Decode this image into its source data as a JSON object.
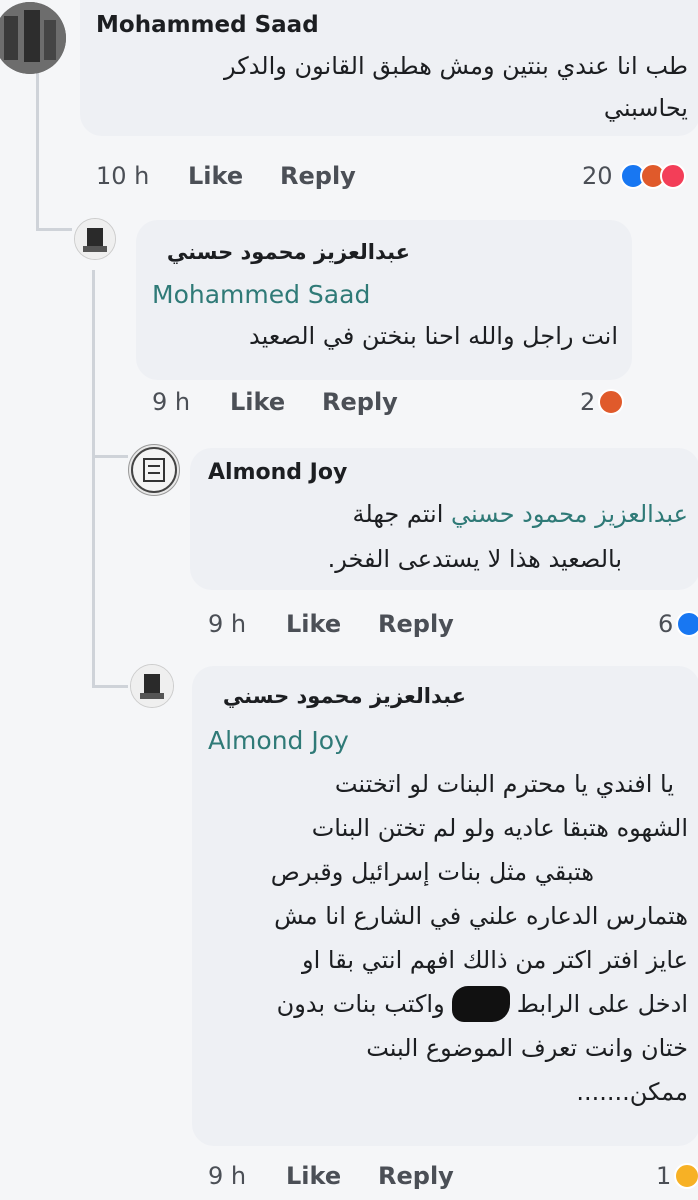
{
  "comments": [
    {
      "author": "Mohammed Saad",
      "mention": "",
      "lines": [
        "طب انا عندي بنتين ومش هطبق القانون والدكر",
        "يحاسبني"
      ],
      "time": "10 h",
      "like_label": "Like",
      "reply_label": "Reply",
      "reaction_count": "20",
      "reactions": [
        "like-icon",
        "angry-icon",
        "love-icon"
      ]
    },
    {
      "author": "عبدالعزيز محمود حسني",
      "mention": "Mohammed Saad",
      "lines": [
        "انت راجل والله احنا بنختن في الصعيد"
      ],
      "time": "9 h",
      "like_label": "Like",
      "reply_label": "Reply",
      "reaction_count": "2",
      "reactions": [
        "angry-icon"
      ]
    },
    {
      "author": "Almond Joy",
      "mention": "عبدالعزيز محمود حسني",
      "lines": [
        "انتم جهلة",
        "بالصعيد هذا لا يستدعى الفخر."
      ],
      "time": "9 h",
      "like_label": "Like",
      "reply_label": "Reply",
      "reaction_count": "6",
      "reactions": [
        "like-icon"
      ]
    },
    {
      "author": "عبدالعزيز محمود حسني",
      "mention": "Almond Joy",
      "lines": [
        "يا افندي يا محترم البنات لو اتختنت",
        "الشهوه هتبقا عاديه ولو لم تختن البنات",
        "هتبقي مثل بنات إسرائيل وقبرص",
        "هتمارس الدعاره علني في الشارع انا مش",
        "عايز افتر اكتر من ذالك افهم انتي بقا او",
        "ادخل على الرابط xxxx واكتب بنات بدون",
        "ختان وانت تعرف الموضوع البنت",
        "ممكن......."
      ],
      "time": "9 h",
      "like_label": "Like",
      "reply_label": "Reply",
      "reaction_count": "1",
      "reactions": [
        "haha-icon"
      ]
    }
  ],
  "colors": {
    "background": "#f5f6f8",
    "bubble": "#eef0f4",
    "mention": "#2f7a77",
    "meta": "#4b4f56",
    "like_blue": "#1877f2",
    "angry_orange": "#e05a2b"
  }
}
